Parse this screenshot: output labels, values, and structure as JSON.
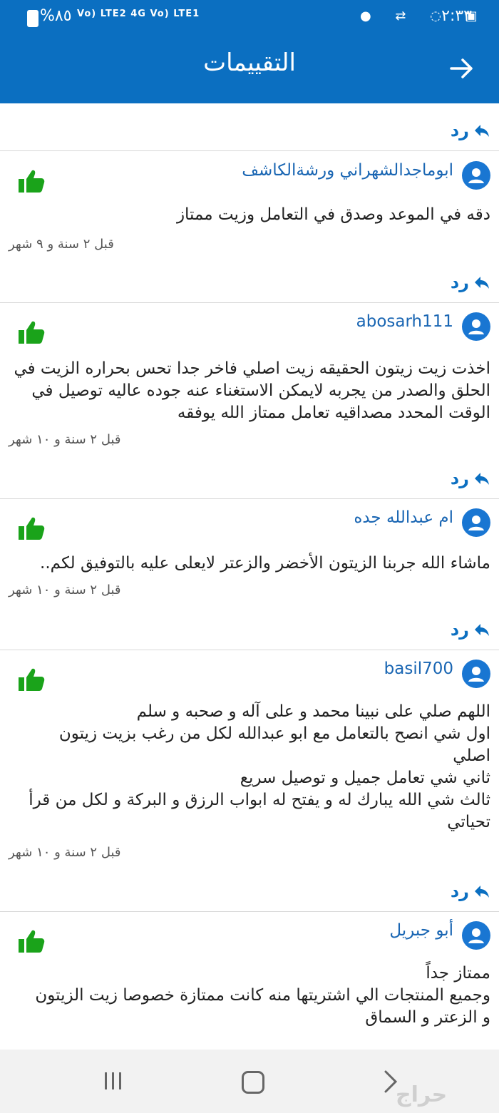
{
  "status_bar": {
    "time": "٢:٣٣",
    "battery_percent": "%٨٥",
    "network": "Vo) LTE2  4G Vo) LTE1",
    "icons": [
      "battery-icon",
      "signal-icon",
      "hotspot-icon",
      "gallery-icon",
      "link-icon",
      "notification-dot-icon"
    ]
  },
  "app_bar": {
    "title": "التقييمات",
    "back_icon": "arrow-right-icon"
  },
  "reply_label": "رد",
  "reviews": [
    {
      "user": "ابوماجدالشهراني ورشةالكاشف",
      "comment": "دقه في الموعد وصدق في التعامل وزيت ممتاز",
      "age": "قبل ٢ سنة و ٩ شهر"
    },
    {
      "user": "abosarh111",
      "comment": "اخذت زيت زيتون الحقيقه زيت اصلي فاخر جدا تحس بحراره الزيت في\nالحلق والصدر من يجربه لايمكن الاستغناء عنه جوده عاليه توصيل في\nالوقت المحدد مصداقيه  تعامل ممتاز الله يوفقه",
      "age": "قبل ٢ سنة و ١٠ شهر"
    },
    {
      "user": "ام عبدالله جده",
      "comment": "ماشاء الله جربنا الزيتون الأخضر والزعتر لايعلى عليه    بالتوفيق لكم..",
      "age": "قبل ٢ سنة و ١٠ شهر"
    },
    {
      "user": "basil700",
      "comment": "اللهم صلي على نبينا محمد و على آله و صحبه و سلم\nاول شي انصح بالتعامل مع ابو عبدالله لكل من رغب بزيت زيتون\nاصلي\nثاني شي تعامل جميل و توصيل سريع\nثالث شي الله يبارك له و يفتح له ابواب الرزق و البركة و لكل من قرأ\nتحياتي",
      "age": "قبل ٢ سنة و ١٠ شهر"
    },
    {
      "user": "أبو جبريل",
      "comment": "ممتاز جداً\nوجميع المنتجات الي اشتريتها منه كانت ممتازة  خصوصا زيت الزيتون\nو الزعتر و السماق",
      "age": ""
    }
  ],
  "nav_bar": {
    "icons": [
      "recent-apps-icon",
      "home-icon",
      "back-icon"
    ]
  },
  "watermark": "حراج",
  "colors": {
    "primary": "#0b6fc1",
    "like_green": "#1aa31a",
    "username_blue": "#1a66b3"
  }
}
